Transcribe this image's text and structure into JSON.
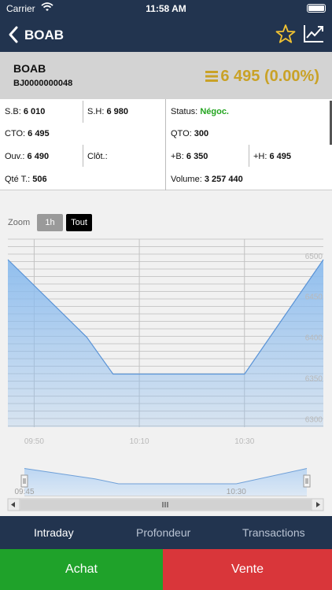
{
  "status_bar": {
    "carrier": "Carrier",
    "time": "11:58 AM"
  },
  "nav": {
    "title": "BOAB"
  },
  "quote": {
    "symbol": "BOAB",
    "code": "BJ0000000048",
    "price": "6 495 (0.00%)",
    "price_color": "#c9a227"
  },
  "info": {
    "sb_label": "S.B:",
    "sb_value": "6 010",
    "sh_label": "S.H:",
    "sh_value": "6 980",
    "status_label": "Status:",
    "status_value": "Négoc.",
    "cto_label": "CTO:",
    "cto_value": "6 495",
    "qto_label": "QTO:",
    "qto_value": "300",
    "ouv_label": "Ouv.:",
    "ouv_value": "6 490",
    "clot_label": "Clôt.:",
    "clot_value": "",
    "plusb_label": "+B:",
    "plusb_value": "6 350",
    "plush_label": "+H:",
    "plush_value": "6 495",
    "qte_label": "Qté T.:",
    "qte_value": "506",
    "volume_label": "Volume:",
    "volume_value": "3 257 440"
  },
  "zoom": {
    "label": "Zoom",
    "options": [
      "1h",
      "Tout"
    ],
    "selected": "Tout"
  },
  "chart_data": {
    "type": "area",
    "x": [
      "09:45",
      "10:00",
      "10:05",
      "10:15",
      "10:30",
      "10:45"
    ],
    "y": [
      6495,
      6400,
      6355,
      6355,
      6355,
      6495
    ],
    "x_ticks": [
      "09:50",
      "10:10",
      "10:30"
    ],
    "y_ticks": [
      "6500",
      "6450",
      "6400",
      "6350",
      "6300"
    ],
    "ylim": [
      6290,
      6520
    ],
    "grid": true,
    "fill_color": "#8cbcee",
    "navigator": {
      "ticks": [
        "09:45",
        "10:30"
      ]
    }
  },
  "tabs": [
    "Intraday",
    "Profondeur",
    "Transactions"
  ],
  "actions": {
    "buy": "Achat",
    "sell": "Vente",
    "buy_color": "#1fa22a",
    "sell_color": "#d9363a"
  }
}
